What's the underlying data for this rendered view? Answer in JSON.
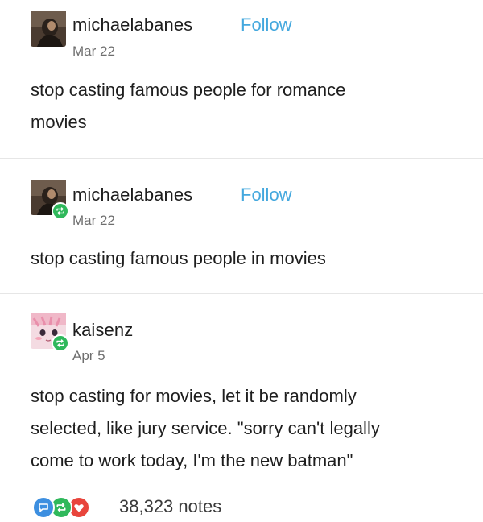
{
  "posts": [
    {
      "username": "michaelabanes",
      "follow_label": "Follow",
      "date": "Mar 22",
      "text": "stop casting famous people for romance movies",
      "line1": "stop casting famous people for romance",
      "line2": "movies",
      "avatar_icon": "dark-avatar-icon",
      "reblogged": false
    },
    {
      "username": "michaelabanes",
      "follow_label": "Follow",
      "date": "Mar 22",
      "text": "stop casting famous people in movies",
      "avatar_icon": "dark-avatar-icon",
      "reblogged": true
    },
    {
      "username": "kaisenz",
      "date": "Apr 5",
      "line1": "stop casting for movies, let it be randomly",
      "line2": "selected, like jury service. \"sorry can't legally",
      "line3": "come to work today, I'm the new batman\"",
      "avatar_icon": "pink-anime-avatar-icon",
      "reblogged": true
    }
  ],
  "notes": {
    "count_label": "38,323 notes",
    "icons": [
      "reply-icon",
      "reblog-icon",
      "like-icon"
    ]
  },
  "colors": {
    "follow": "#44a8de",
    "reblog_badge": "#2fb85b",
    "reply_icon": "#3d8fe0",
    "like_icon": "#e8453c",
    "divider": "#e6e6e6"
  }
}
